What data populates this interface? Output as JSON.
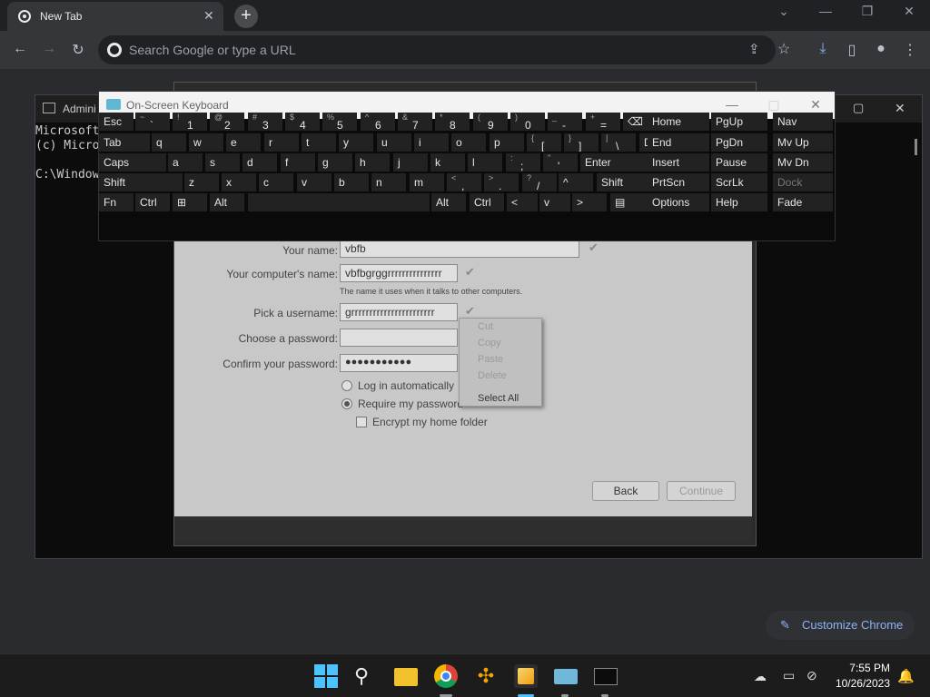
{
  "chrome": {
    "tab_title": "New Tab",
    "tab_close": "✕",
    "new_tab": "+",
    "omnibox_placeholder": "Search Google or type a URL",
    "customize_label": "Customize Chrome"
  },
  "cmd": {
    "title": "Admini",
    "line1": "Microsoft",
    "line2": "(c) Micro",
    "line3": "",
    "line4": "C:\\Window"
  },
  "installer": {
    "fields": [
      {
        "label": "Your name:",
        "value": "vbfb"
      },
      {
        "label": "Your computer's name:",
        "value": "vbfbgrggrrrrrrrrrrrrrrr"
      },
      {
        "label": "Pick a username:",
        "value": "grrrrrrrrrrrrrrrrrrrrrrr"
      },
      {
        "label": "Choose a password:",
        "value": ""
      },
      {
        "label": "Confirm your password:",
        "value": "●●●●●●●●●●●"
      }
    ],
    "hint": "The name it uses when it talks to other computers.",
    "opt_auto": "Log in automatically",
    "opt_require": "Require my password",
    "opt_encrypt": "Encrypt my home folder",
    "back": "Back",
    "continue": "Continue",
    "check": "✔"
  },
  "context_menu": {
    "cut": "Cut",
    "copy": "Copy",
    "paste": "Paste",
    "delete": "Delete",
    "select_all": "Select All"
  },
  "osk": {
    "title": "On-Screen Keyboard",
    "row1": [
      {
        "k": "esc",
        "m": "Esc"
      },
      {
        "k": "grave",
        "s": "~",
        "m": "`"
      },
      {
        "k": "1",
        "s": "!",
        "m": "1"
      },
      {
        "k": "2",
        "s": "@",
        "m": "2"
      },
      {
        "k": "3",
        "s": "#",
        "m": "3"
      },
      {
        "k": "4",
        "s": "$",
        "m": "4"
      },
      {
        "k": "5",
        "s": "%",
        "m": "5"
      },
      {
        "k": "6",
        "s": "^",
        "m": "6"
      },
      {
        "k": "7",
        "s": "&",
        "m": "7"
      },
      {
        "k": "8",
        "s": "*",
        "m": "8"
      },
      {
        "k": "9",
        "s": "(",
        "m": "9"
      },
      {
        "k": "0",
        "s": ")",
        "m": "0"
      },
      {
        "k": "minus",
        "s": "_",
        "m": "-"
      },
      {
        "k": "equals",
        "s": "+",
        "m": "="
      },
      {
        "k": "backspace",
        "m": "⌫"
      }
    ],
    "row2": [
      {
        "k": "tab",
        "m": "Tab"
      },
      {
        "k": "q",
        "m": "q"
      },
      {
        "k": "w",
        "m": "w"
      },
      {
        "k": "e",
        "m": "e"
      },
      {
        "k": "r",
        "m": "r"
      },
      {
        "k": "t",
        "m": "t"
      },
      {
        "k": "y",
        "m": "y"
      },
      {
        "k": "u",
        "m": "u"
      },
      {
        "k": "i",
        "m": "i"
      },
      {
        "k": "o",
        "m": "o"
      },
      {
        "k": "p",
        "m": "p"
      },
      {
        "k": "lbracket",
        "s": "{",
        "m": "["
      },
      {
        "k": "rbracket",
        "s": "}",
        "m": "]"
      },
      {
        "k": "backslash",
        "s": "|",
        "m": "\\"
      },
      {
        "k": "del",
        "m": "Del"
      }
    ],
    "row3": [
      {
        "k": "caps",
        "m": "Caps"
      },
      {
        "k": "a",
        "m": "a"
      },
      {
        "k": "s",
        "m": "s"
      },
      {
        "k": "d",
        "m": "d"
      },
      {
        "k": "f",
        "m": "f"
      },
      {
        "k": "g",
        "m": "g"
      },
      {
        "k": "h",
        "m": "h"
      },
      {
        "k": "j",
        "m": "j"
      },
      {
        "k": "k",
        "m": "k"
      },
      {
        "k": "l",
        "m": "l"
      },
      {
        "k": "semicolon",
        "s": ":",
        "m": ";"
      },
      {
        "k": "quote",
        "s": "\"",
        "m": "'"
      },
      {
        "k": "enter",
        "m": "Enter"
      }
    ],
    "row4": [
      {
        "k": "lshift",
        "m": "Shift"
      },
      {
        "k": "z",
        "m": "z"
      },
      {
        "k": "x",
        "m": "x"
      },
      {
        "k": "c",
        "m": "c"
      },
      {
        "k": "v",
        "m": "v"
      },
      {
        "k": "b",
        "m": "b"
      },
      {
        "k": "n",
        "m": "n"
      },
      {
        "k": "m",
        "m": "m"
      },
      {
        "k": "comma",
        "s": "<",
        "m": ","
      },
      {
        "k": "period",
        "s": ">",
        "m": "."
      },
      {
        "k": "slash",
        "s": "?",
        "m": "/"
      },
      {
        "k": "up",
        "m": "^"
      },
      {
        "k": "rshift",
        "m": "Shift"
      }
    ],
    "row5": [
      {
        "k": "fn",
        "m": "Fn"
      },
      {
        "k": "lctrl",
        "m": "Ctrl"
      },
      {
        "k": "win",
        "m": "⊞"
      },
      {
        "k": "lalt",
        "m": "Alt"
      },
      {
        "k": "space",
        "m": ""
      },
      {
        "k": "ralt",
        "m": "Alt"
      },
      {
        "k": "rctrl",
        "m": "Ctrl"
      },
      {
        "k": "left",
        "m": "<"
      },
      {
        "k": "down",
        "m": "v"
      },
      {
        "k": "right",
        "m": ">"
      },
      {
        "k": "menu",
        "m": "▤"
      }
    ],
    "nav": [
      [
        "Home",
        "PgUp",
        "Nav"
      ],
      [
        "End",
        "PgDn",
        "Mv Up"
      ],
      [
        "Insert",
        "Pause",
        "Mv Dn"
      ],
      [
        "PrtScn",
        "ScrLk",
        "Dock"
      ],
      [
        "Options",
        "Help",
        "Fade"
      ]
    ]
  },
  "taskbar": {
    "time": "7:55 PM",
    "date": "10/26/2023"
  }
}
